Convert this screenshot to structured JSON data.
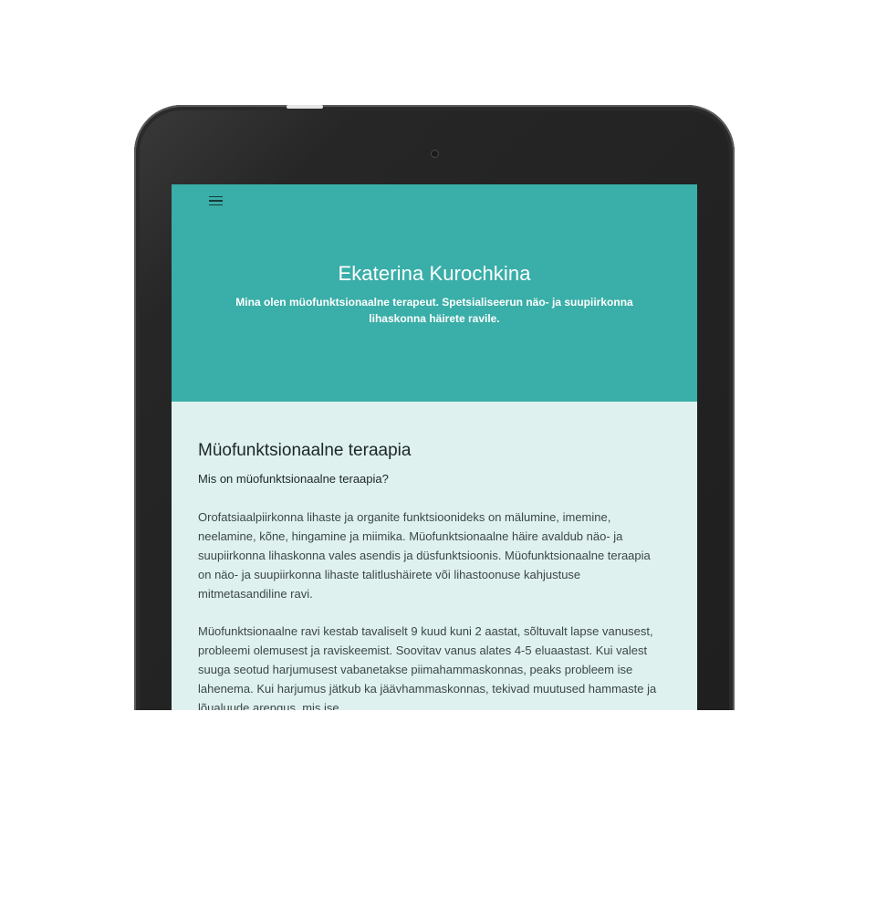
{
  "site": {
    "title": "Ekaterina Kurochkina",
    "subtitle": "Mina olen müofunktsionaalne terapeut. Spetsialiseerun näo- ja suupiirkonna lihaskonna häirete ravile."
  },
  "nav": {
    "menu_icon": "hamburger-menu-icon"
  },
  "section": {
    "title": "Müofunktsionaalne teraapia",
    "question": "Mis on müofunktsionaalne teraapia?",
    "paragraphs": [
      "Orofatsiaalpiirkonna lihaste ja organite funktsioonideks on mälumine, imemine, neelamine, kõne, hingamine ja miimika. Müofunktsionaalne häire avaldub näo- ja suupiirkonna lihaskonna vales asendis ja düsfunktsioonis. Müofunktsionaalne teraapia on näo- ja suupiirkonna lihaste talitlushäirete või lihastoonuse kahjustuse mitmetasandiline ravi.",
      "Müofunktsionaalne ravi kestab tavaliselt 9 kuud kuni 2 aastat, sõltuvalt lapse vanusest, probleemi olemusest ja raviskeemist. Soovitav vanus alates 4-5 eluaastast. Kui valest suuga seotud harjumusest vabanetakse piimahammaskonnas, peaks probleem ise lahenema. Kui harjumus jätkub ka jäävhammaskonnas, tekivad muutused hammaste ja lõualuude arengus, mis ise"
    ]
  },
  "colors": {
    "hero_bg": "#3aaea8",
    "content_bg": "#def1ef",
    "device_body": "#222222"
  }
}
